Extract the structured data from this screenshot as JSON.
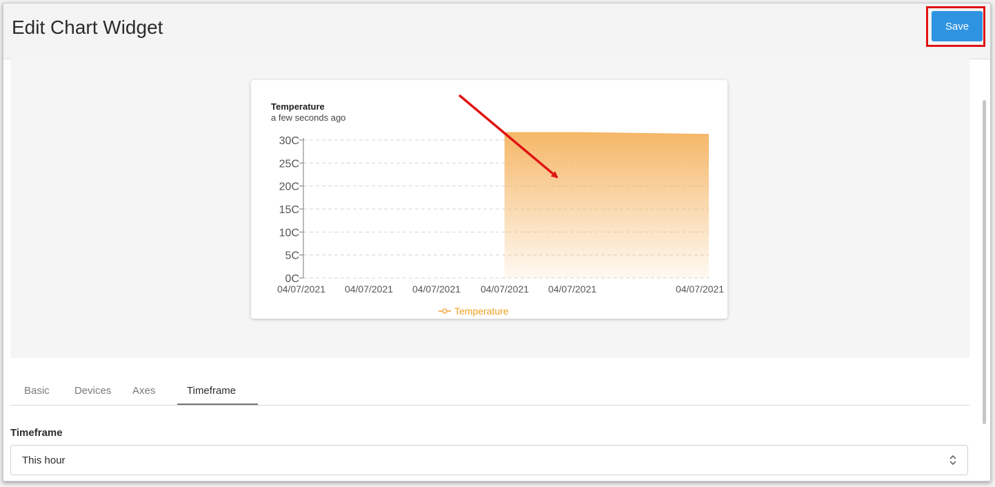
{
  "header": {
    "title": "Edit Chart Widget",
    "save_label": "Save"
  },
  "widget": {
    "title": "Temperature",
    "subtitle": "a few seconds ago",
    "legend_label": "Temperature"
  },
  "chart_data": {
    "type": "area",
    "title": "Temperature",
    "xlabel": "",
    "ylabel": "",
    "ylim": [
      0,
      32
    ],
    "y_ticks": [
      "30C",
      "25C",
      "20C",
      "15C",
      "10C",
      "5C",
      "0C"
    ],
    "x_tick_labels": [
      "04/07/2021",
      "04/07/2021",
      "04/07/2021",
      "04/07/2021",
      "04/07/2021",
      "04/07/2021"
    ],
    "series": [
      {
        "name": "Temperature",
        "x_fraction": [
          0.496,
          0.68,
          1.0
        ],
        "values": [
          31.6,
          31.6,
          31.2
        ]
      }
    ],
    "grid": true,
    "legend": "bottom-center",
    "color": "#f5b461"
  },
  "tabs": [
    {
      "label": "Basic"
    },
    {
      "label": "Devices"
    },
    {
      "label": "Axes"
    },
    {
      "label": "Timeframe"
    }
  ],
  "timeframe": {
    "label": "Timeframe",
    "value": "This hour"
  },
  "colors": {
    "accent": "#2e93e1",
    "highlight": "#e01414",
    "series": "#f5b461",
    "legend_text": "#f0a020"
  }
}
